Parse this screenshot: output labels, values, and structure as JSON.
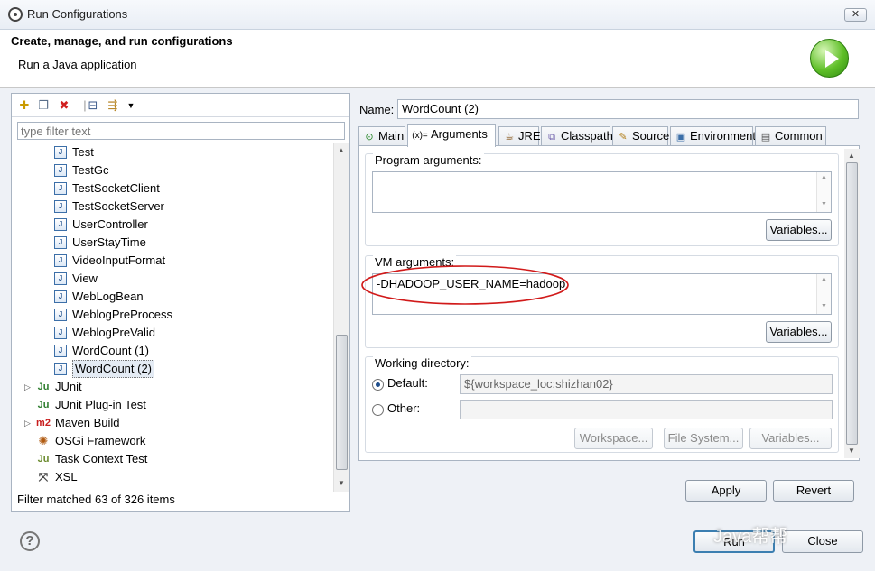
{
  "window": {
    "title": "Run Configurations",
    "close_label": "✕"
  },
  "header": {
    "title": "Create, manage, and run configurations",
    "subtitle": "Run a Java application"
  },
  "left": {
    "filter_placeholder": "type filter text",
    "tree": [
      {
        "label": "Test",
        "kind": "java",
        "indent": 2
      },
      {
        "label": "TestGc",
        "kind": "java",
        "indent": 2
      },
      {
        "label": "TestSocketClient",
        "kind": "java",
        "indent": 2
      },
      {
        "label": "TestSocketServer",
        "kind": "java",
        "indent": 2
      },
      {
        "label": "UserController",
        "kind": "java",
        "indent": 2
      },
      {
        "label": "UserStayTime",
        "kind": "java",
        "indent": 2
      },
      {
        "label": "VideoInputFormat",
        "kind": "java",
        "indent": 2
      },
      {
        "label": "View",
        "kind": "java",
        "indent": 2
      },
      {
        "label": "WebLogBean",
        "kind": "java",
        "indent": 2
      },
      {
        "label": "WeblogPreProcess",
        "kind": "java",
        "indent": 2
      },
      {
        "label": "WeblogPreValid",
        "kind": "java",
        "indent": 2
      },
      {
        "label": "WordCount (1)",
        "kind": "java",
        "indent": 2
      },
      {
        "label": "WordCount (2)",
        "kind": "java",
        "indent": 2,
        "selected": true
      },
      {
        "label": "JUnit",
        "kind": "junit",
        "indent": 1,
        "expandable": true
      },
      {
        "label": "JUnit Plug-in Test",
        "kind": "junit-plugin",
        "indent": 1
      },
      {
        "label": "Maven Build",
        "kind": "maven",
        "indent": 1,
        "expandable": true
      },
      {
        "label": "OSGi Framework",
        "kind": "osgi",
        "indent": 1
      },
      {
        "label": "Task Context Test",
        "kind": "task",
        "indent": 1
      },
      {
        "label": "XSL",
        "kind": "xsl",
        "indent": 1
      }
    ],
    "status": "Filter matched 63 of 326 items"
  },
  "config": {
    "name_label": "Name:",
    "name_value": "WordCount (2)",
    "tabs": [
      {
        "label": "Main",
        "icon": "main-icon"
      },
      {
        "label": "Arguments",
        "icon": "arguments-icon",
        "prefix": "(x)="
      },
      {
        "label": "JRE",
        "icon": "jre-icon"
      },
      {
        "label": "Classpath",
        "icon": "classpath-icon"
      },
      {
        "label": "Source",
        "icon": "source-icon"
      },
      {
        "label": "Environment",
        "icon": "environment-icon"
      },
      {
        "label": "Common",
        "icon": "common-icon"
      }
    ],
    "program_args_label": "Program arguments:",
    "program_args_value": "",
    "variables_label": "Variables...",
    "vm_args_label": "VM arguments:",
    "vm_args_value": "-DHADOOP_USER_NAME=hadoop",
    "workdir_label": "Working directory:",
    "default_label": "Default:",
    "default_value": "${workspace_loc:shizhan02}",
    "other_label": "Other:",
    "other_value": "",
    "workspace_btn": "Workspace...",
    "filesystem_btn": "File System...",
    "variables_btn2": "Variables...",
    "apply": "Apply",
    "revert": "Revert"
  },
  "footer": {
    "run": "Run",
    "close": "Close",
    "watermark": "Java帮帮"
  },
  "colors": {
    "highlight_ellipse": "#d11a1a"
  }
}
